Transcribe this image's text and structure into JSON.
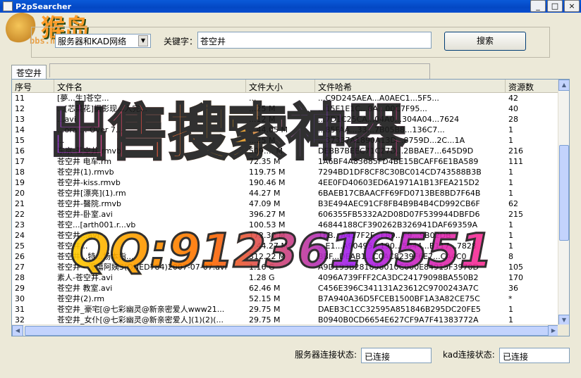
{
  "window": {
    "title": "P2pSearcher",
    "minimize": "_",
    "maximize": "□",
    "close": "×"
  },
  "logo": {
    "char": "猴岛",
    "url": "bbs.houdao.com"
  },
  "search": {
    "network": "服务器和KAD网络",
    "keyword_label": "关键字：",
    "keyword": "苍空井",
    "button": "搜索"
  },
  "tab": {
    "label": "苍空井"
  },
  "list": {
    "columns": [
      "序号",
      "文件名",
      "文件大小",
      "文件哈希",
      "资源数"
    ],
    "rows": [
      [
        "11",
        "[夢...生]苍空...",
        "...",
        "...C9D245AEA...A0AEC1...5F5...",
        "42"
      ],
      [
        "12",
        "...[芯菜花]摄影现...入完...",
        "...25 M",
        "...15E1E1C...8A...00C7F95...",
        "40"
      ],
      [
        "13",
        "...avi",
        "...12 M",
        "...7D1C25CA...04A0...304A04...7624",
        "28"
      ],
      [
        "14",
        "...ora ... Over 7...",
        "...44.05 M",
        "...85FAA...33...7B05B8...136C7...",
        "1"
      ],
      [
        "15",
        "...",
        "...25 M",
        "...37337A1890A13D...8759D...2C...1A",
        "1"
      ],
      [
        "16",
        "东京-苍空井.rmvb",
        "509.... M",
        "DEBB7BEEC71C27D...2BBAE7...645D9D",
        "216"
      ],
      [
        "17",
        "苍空井 电车.rm",
        "72.35 M",
        "1A6BF4A83685FD4BE15BCAFF6E1BA589",
        "111"
      ],
      [
        "18",
        "苍空井(1).rmvb",
        "119.75 M",
        "7294BD1DF8CF8C30BC014CD743588B3B",
        "1"
      ],
      [
        "19",
        "苍空井-kiss.rmvb",
        "190.46 M",
        "4EE0FD40603ED6A1971A1B13FEA215D2",
        "1"
      ],
      [
        "20",
        "苍空井[漂亮](1).rm",
        "44.27 M",
        "6BAEB17CBAACFF69FD0713BE8BD7F64B",
        "1"
      ],
      [
        "21",
        "苍空井-醫院.rmvb",
        "47.09 M",
        "B3E494AEC91CF8FB4B9B4B4CD992CB6F",
        "62"
      ],
      [
        "22",
        "苍空井-卧室.avi",
        "396.27 M",
        "606355FB5332A2D08D07F539944DBFD6",
        "215"
      ],
      [
        "23",
        "苍空...[arth001.r...vb",
        "100.53 M",
        "46844188CF390262B326941DAF69359A",
        "1"
      ],
      [
        "24",
        "苍空井...avi",
        "172.30 M",
        "1EB...A417F2F...FB9...F9...9B02DB",
        "1"
      ],
      [
        "25",
        "苍空井...",
        "...44.27 M",
        "...E1...A90495...190...5044...B117...7828",
        "1"
      ],
      [
        "26",
        "苍空井...特...场本指...",
        "312.22 M",
        "BBF...DEAB1...C0AC8239F6E7...CA4C0",
        "8"
      ],
      [
        "27",
        "苍空井 - 淫蕩阿姨3(ONED784)2007-07-07.avi",
        "1.16 G",
        "A9D193B281898010C000E84915F3970D",
        "105"
      ],
      [
        "28",
        "素人-苍空井.avi",
        "1.28 G",
        "4096A739FFF2CA3DC24179098BA550B2",
        "170"
      ],
      [
        "29",
        "苍空井 教室.avi",
        "62.46 M",
        "C456E396C341131A23612C9700243A7C",
        "36"
      ],
      [
        "30",
        "苍空井(2).rm",
        "52.15 M",
        "B7A940A36D5FCEB1500BF1A3A82CE75C",
        "*"
      ],
      [
        "31",
        "苍空井_豪宅[@七彩幽灵@新亲密爱人www21...",
        "29.75 M",
        "DAEB3C1CC32595A851846B295DC20FE5",
        "1"
      ],
      [
        "32",
        "苍空井_女仆[@七彩幽灵@新亲密爱人](1)(2)(...",
        "29.75 M",
        "B0940B0CD6654E627CF9A7F41383772A",
        "1"
      ]
    ]
  },
  "overlay": {
    "banner": "出售搜索神器",
    "qq": "QQ:9123616551"
  },
  "status": {
    "server_label": "服务器连接状态:",
    "server_value": "已连接",
    "kad_label": "kad连接状态:",
    "kad_value": "已连接"
  }
}
